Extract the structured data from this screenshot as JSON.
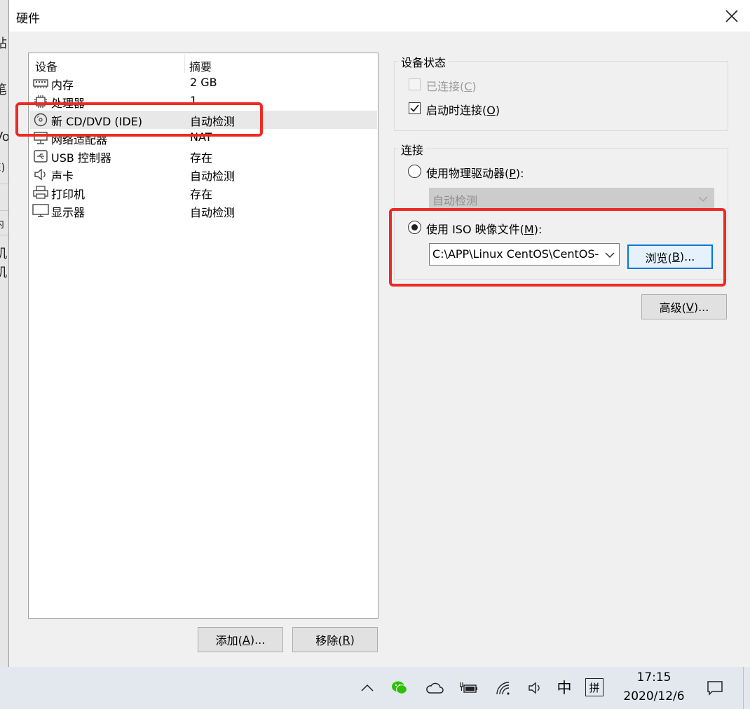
{
  "window": {
    "title": "硬件"
  },
  "device_list": {
    "headers": {
      "device": "设备",
      "summary": "摘要"
    },
    "rows": [
      {
        "icon": "memory-icon",
        "name": "内存",
        "summary": "2 GB"
      },
      {
        "icon": "processor-icon",
        "name": "处理器",
        "summary": "1"
      },
      {
        "icon": "cd-dvd-icon",
        "name": "新 CD/DVD (IDE)",
        "summary": "自动检测"
      },
      {
        "icon": "network-adapter-icon",
        "name": "网络适配器",
        "summary": "NAT"
      },
      {
        "icon": "usb-icon",
        "name": "USB 控制器",
        "summary": "存在"
      },
      {
        "icon": "speaker-icon",
        "name": "声卡",
        "summary": "自动检测"
      },
      {
        "icon": "printer-icon",
        "name": "打印机",
        "summary": "存在"
      },
      {
        "icon": "display-icon",
        "name": "显示器",
        "summary": "自动检测"
      }
    ],
    "selected_index": 2
  },
  "buttons": {
    "add": {
      "text": "添加(",
      "key": "A",
      "tail": ")..."
    },
    "remove": {
      "text": "移除(",
      "key": "R",
      "tail": ")"
    },
    "browse": {
      "text": "浏览(",
      "key": "B",
      "tail": ")..."
    },
    "advanced": {
      "text": "高级(",
      "key": "V",
      "tail": ")..."
    }
  },
  "device_status": {
    "title": "设备状态",
    "connected": {
      "text": "已连接(",
      "key": "C",
      "tail": ")",
      "checked": false,
      "enabled": false
    },
    "connect_at_power_on": {
      "text": "启动时连接(",
      "key": "O",
      "tail": ")",
      "checked": true,
      "enabled": true
    }
  },
  "connection": {
    "title": "连接",
    "physical": {
      "text": "使用物理驱动器(",
      "key": "P",
      "tail": "):",
      "selected": false,
      "value": "自动检测"
    },
    "iso": {
      "text": "使用 ISO 映像文件(",
      "key": "M",
      "tail": "):",
      "selected": true,
      "value": "C:\\APP\\Linux CentOS\\CentOS-"
    }
  },
  "taskbar": {
    "time": "17:15",
    "date": "2020/12/6",
    "ime_lang": "中",
    "ime_mode": "拼"
  },
  "background_fragments": [
    "站",
    "笔",
    "Vo",
    "E)",
    "内",
    "机",
    "机"
  ],
  "colors": {
    "highlight_red": "#ee2a24",
    "focus_blue": "#0078d7",
    "wechat_green": "#2dc100"
  }
}
